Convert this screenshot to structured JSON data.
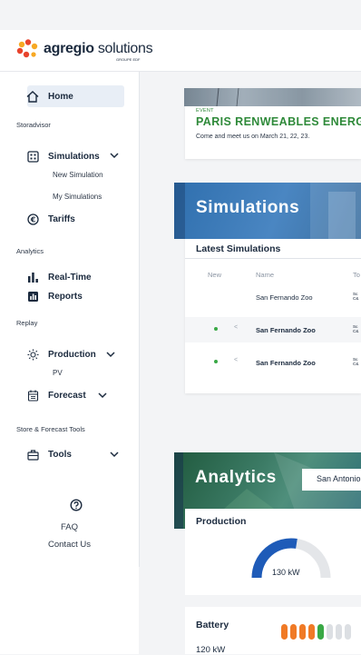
{
  "brand": {
    "name_bold": "agregio",
    "name_light": " solutions",
    "sub": "GROUPE EDF"
  },
  "sidebar": {
    "home": "Home",
    "sections": {
      "storadvisor": "Storadvisor",
      "analytics": "Analytics",
      "replay": "Replay",
      "store_forecast": "Store & Forecast Tools"
    },
    "simulations": "Simulations",
    "new_simulation": "New Simulation",
    "my_simulations": "My Simulations",
    "tariffs": "Tariffs",
    "realtime": "Real-Time",
    "reports": "Reports",
    "production": "Production",
    "pv": "PV",
    "forecast": "Forecast",
    "tools": "Tools",
    "faq": "FAQ",
    "contact": "Contact Us"
  },
  "event": {
    "tag": "EVENT",
    "title": "PARIS RENWEABLES ENERGY",
    "subtitle": "Come and meet us on March 21, 22, 23."
  },
  "simulations": {
    "banner": "Simulations",
    "latest": "Latest Simulations",
    "columns": {
      "new": "New",
      "name": "Name",
      "type": "To"
    },
    "rows": [
      {
        "name": "San Fernando Zoo",
        "type_line1": "Sc",
        "type_line2": "C&"
      },
      {
        "name": "San Fernando Zoo",
        "type_line1": "Sc",
        "type_line2": "C&"
      },
      {
        "name": "San Fernando Zoo",
        "type_line1": "Sc",
        "type_line2": "C&"
      }
    ]
  },
  "analytics": {
    "banner": "Analytics",
    "site_select": "San Antonio",
    "production_label": "Production",
    "production_value": "130 kW",
    "production_fraction": 0.55,
    "battery_label": "Battery",
    "battery_value": "120 kW",
    "battery_segments_total": 8,
    "battery_segments_filled": 5
  },
  "colors": {
    "accent_green": "#2f8a3a",
    "gauge_blue": "#1e5bb8",
    "battery_orange": "#f07a26",
    "battery_green": "#39a845"
  }
}
